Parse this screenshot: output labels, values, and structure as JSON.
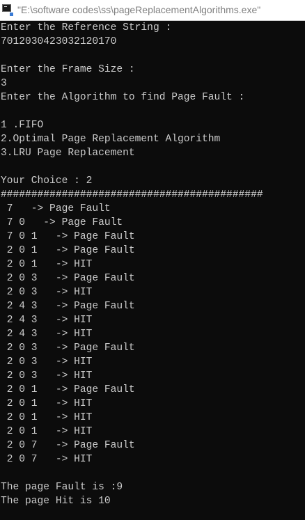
{
  "window": {
    "title": "\"E:\\software codes\\ss\\pageReplacementAlgorithms.exe\"",
    "icon": "console-app-icon"
  },
  "console": {
    "text_color": "#cccccc",
    "background": "#0c0c0c",
    "lines": [
      "Enter the Reference String :",
      "7012030423032120170",
      "",
      "Enter the Frame Size :",
      "3",
      "Enter the Algorithm to find Page Fault :",
      "",
      "1 .FIFO",
      "2.Optimal Page Replacement Algorithm",
      "3.LRU Page Replacement",
      "",
      "Your Choice : 2",
      "###########################################",
      " 7   -> Page Fault",
      " 7 0   -> Page Fault",
      " 7 0 1   -> Page Fault",
      " 2 0 1   -> Page Fault",
      " 2 0 1   -> HIT",
      " 2 0 3   -> Page Fault",
      " 2 0 3   -> HIT",
      " 2 4 3   -> Page Fault",
      " 2 4 3   -> HIT",
      " 2 4 3   -> HIT",
      " 2 0 3   -> Page Fault",
      " 2 0 3   -> HIT",
      " 2 0 3   -> HIT",
      " 2 0 1   -> Page Fault",
      " 2 0 1   -> HIT",
      " 2 0 1   -> HIT",
      " 2 0 1   -> HIT",
      " 2 0 7   -> Page Fault",
      " 2 0 7   -> HIT",
      "",
      "The page Fault is :9",
      "The page Hit is 10"
    ]
  }
}
